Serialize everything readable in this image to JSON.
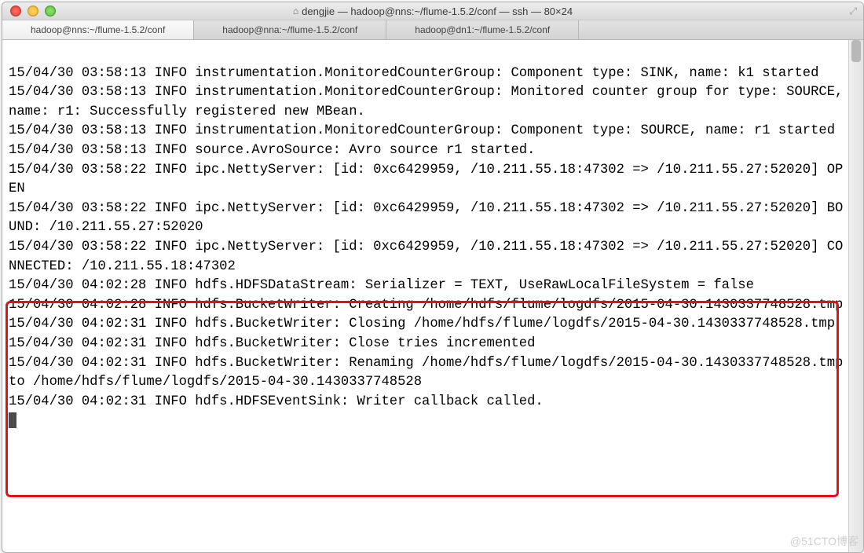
{
  "window": {
    "title": "dengjie — hadoop@nns:~/flume-1.5.2/conf — ssh — 80×24"
  },
  "tabs": [
    {
      "label": "hadoop@nns:~/flume-1.5.2/conf",
      "active": true
    },
    {
      "label": "hadoop@nna:~/flume-1.5.2/conf",
      "active": false
    },
    {
      "label": "hadoop@dn1:~/flume-1.5.2/conf",
      "active": false
    }
  ],
  "log": {
    "lines": [
      "15/04/30 03:58:13 INFO instrumentation.MonitoredCounterGroup: Component type: SINK, name: k1 started",
      "15/04/30 03:58:13 INFO instrumentation.MonitoredCounterGroup: Monitored counter group for type: SOURCE, name: r1: Successfully registered new MBean.",
      "15/04/30 03:58:13 INFO instrumentation.MonitoredCounterGroup: Component type: SOURCE, name: r1 started",
      "15/04/30 03:58:13 INFO source.AvroSource: Avro source r1 started.",
      "15/04/30 03:58:22 INFO ipc.NettyServer: [id: 0xc6429959, /10.211.55.18:47302 => /10.211.55.27:52020] OPEN",
      "15/04/30 03:58:22 INFO ipc.NettyServer: [id: 0xc6429959, /10.211.55.18:47302 => /10.211.55.27:52020] BOUND: /10.211.55.27:52020",
      "15/04/30 03:58:22 INFO ipc.NettyServer: [id: 0xc6429959, /10.211.55.18:47302 => /10.211.55.27:52020] CONNECTED: /10.211.55.18:47302",
      "15/04/30 04:02:28 INFO hdfs.HDFSDataStream: Serializer = TEXT, UseRawLocalFileSystem = false",
      "15/04/30 04:02:28 INFO hdfs.BucketWriter: Creating /home/hdfs/flume/logdfs/2015-04-30.1430337748528.tmp",
      "15/04/30 04:02:31 INFO hdfs.BucketWriter: Closing /home/hdfs/flume/logdfs/2015-04-30.1430337748528.tmp",
      "15/04/30 04:02:31 INFO hdfs.BucketWriter: Close tries incremented",
      "15/04/30 04:02:31 INFO hdfs.BucketWriter: Renaming /home/hdfs/flume/logdfs/2015-04-30.1430337748528.tmp to /home/hdfs/flume/logdfs/2015-04-30.1430337748528",
      "15/04/30 04:02:31 INFO hdfs.HDFSEventSink: Writer callback called."
    ]
  },
  "watermark": "@51CTO博客"
}
